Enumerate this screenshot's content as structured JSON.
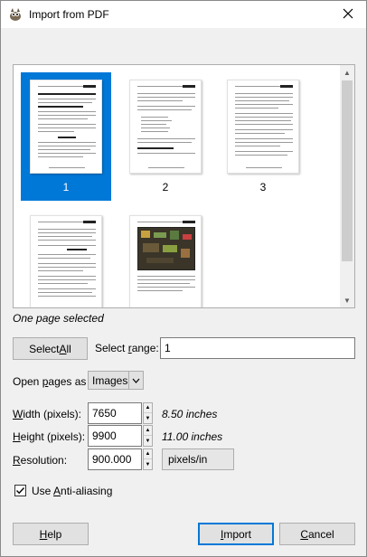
{
  "window": {
    "title": "Import from PDF"
  },
  "thumbnails": [
    {
      "label": "1",
      "selected": true
    },
    {
      "label": "2",
      "selected": false
    },
    {
      "label": "3",
      "selected": false
    },
    {
      "label": "",
      "selected": false
    },
    {
      "label": "",
      "selected": false
    }
  ],
  "status": "One page selected",
  "select_all": {
    "prefix": "Select ",
    "accel": "A",
    "suffix": "ll"
  },
  "select_range": {
    "prefix": "Select ",
    "accel": "r",
    "suffix": "ange:",
    "value": "1"
  },
  "open_pages": {
    "prefix": "Open ",
    "accel": "p",
    "suffix": "ages as",
    "value": "Images"
  },
  "width": {
    "accel": "W",
    "suffix": "idth (pixels):",
    "value": "7650",
    "unit": "8.50 inches"
  },
  "height": {
    "accel": "H",
    "suffix": "eight (pixels):",
    "value": "9900",
    "unit": "11.00 inches"
  },
  "resolution": {
    "accel": "R",
    "suffix": "esolution:",
    "value": "900.000",
    "unit": "pixels/in"
  },
  "antialias": {
    "prefix": "Use ",
    "accel": "A",
    "suffix": "nti-aliasing",
    "checked": true
  },
  "buttons": {
    "help": {
      "accel": "H",
      "suffix": "elp"
    },
    "import": {
      "accel": "I",
      "suffix": "mport"
    },
    "cancel": {
      "accel": "C",
      "suffix": "ancel"
    }
  },
  "colors": {
    "selection": "#0078d7",
    "accent": "#0078d7"
  },
  "icons": {
    "app": "gimp-icon",
    "close": "close-icon"
  }
}
